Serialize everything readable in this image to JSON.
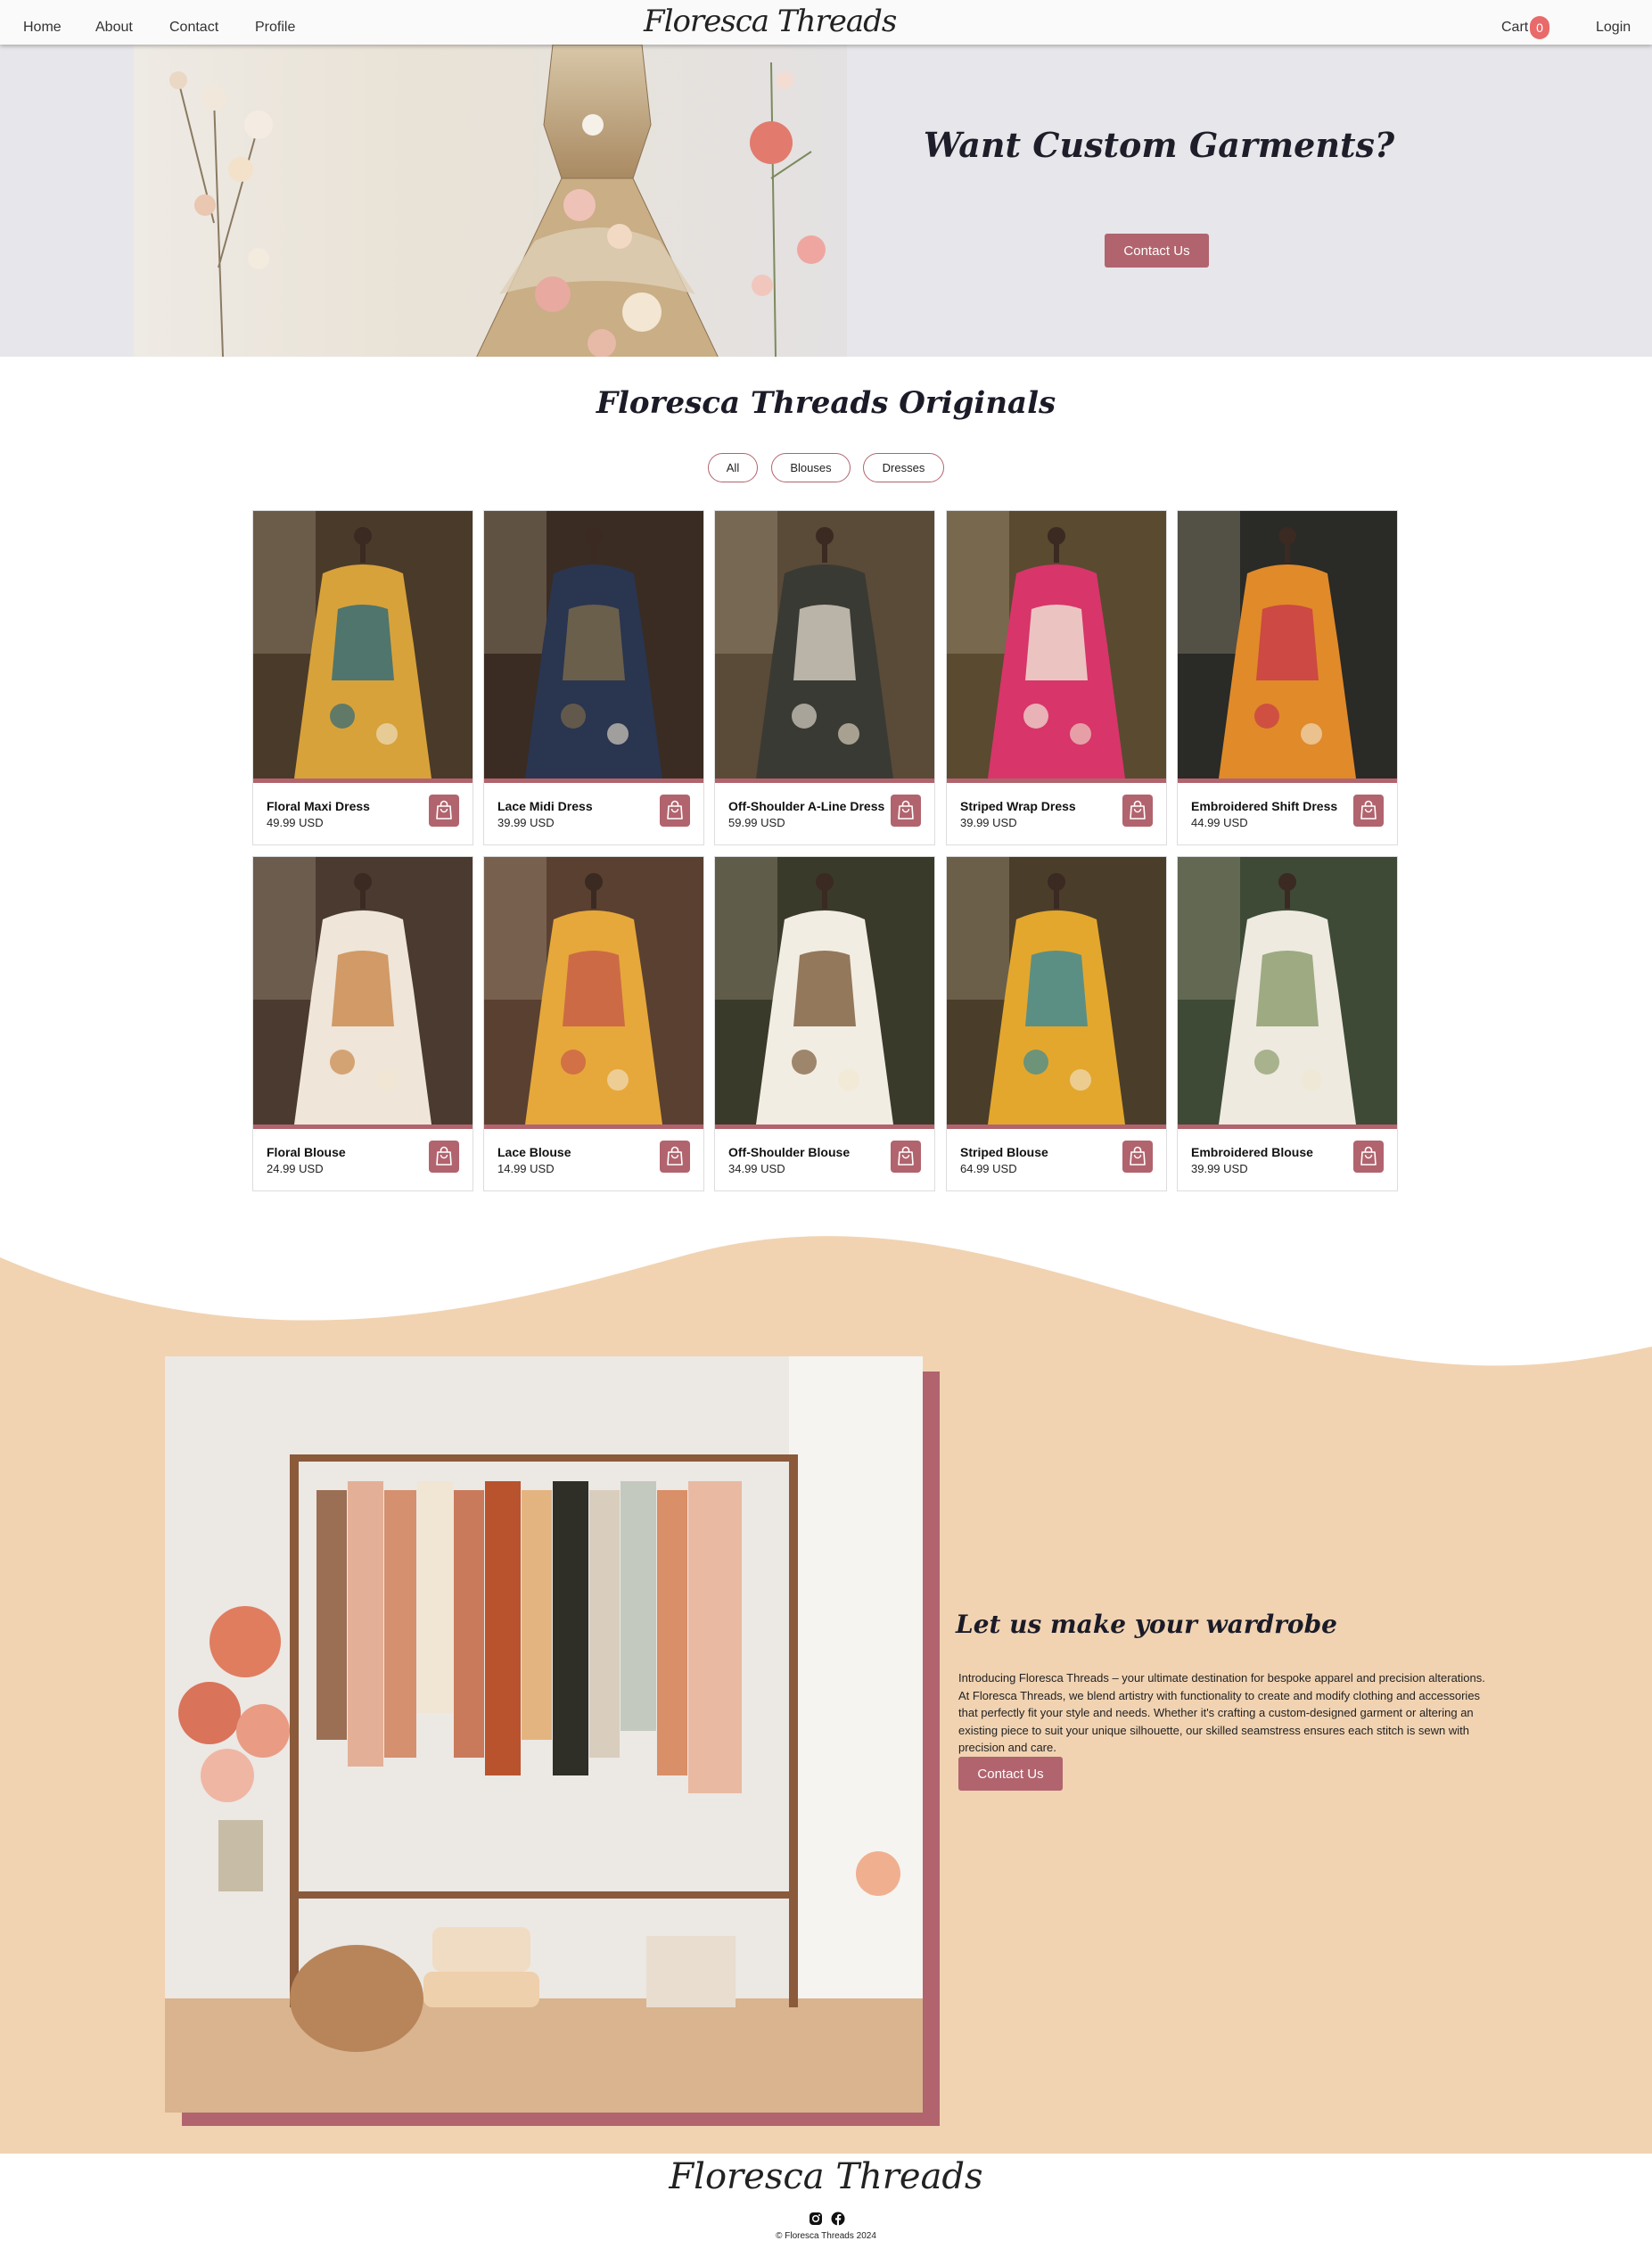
{
  "nav": {
    "links": [
      "Home",
      "About",
      "Contact",
      "Profile"
    ],
    "logo": "Floresca Threads",
    "cart_label": "Cart",
    "cart_count": "0",
    "login": "Login"
  },
  "hero": {
    "title": "Want Custom Garments?",
    "button": "Contact Us"
  },
  "products": {
    "title": "Floresca Threads Originals",
    "filters": [
      "All",
      "Blouses",
      "Dresses"
    ],
    "items": [
      {
        "name": "Floral Maxi Dress",
        "price": "49.99 USD"
      },
      {
        "name": "Lace Midi Dress",
        "price": "39.99 USD"
      },
      {
        "name": "Off-Shoulder A-Line Dress",
        "price": "59.99 USD"
      },
      {
        "name": "Striped Wrap Dress",
        "price": "39.99 USD"
      },
      {
        "name": "Embroidered Shift Dress",
        "price": "44.99 USD"
      },
      {
        "name": "Floral Blouse",
        "price": "24.99 USD"
      },
      {
        "name": "Lace Blouse",
        "price": "14.99 USD"
      },
      {
        "name": "Off-Shoulder Blouse",
        "price": "34.99 USD"
      },
      {
        "name": "Striped Blouse",
        "price": "64.99 USD"
      },
      {
        "name": "Embroidered Blouse",
        "price": "39.99 USD"
      }
    ]
  },
  "about": {
    "title": "Let us make your wardrobe",
    "text": "Introducing Floresca Threads – your ultimate destination for bespoke apparel and precision alterations. At Floresca Threads, we blend artistry with functionality to create and modify clothing and accessories that perfectly fit your style and needs. Whether it's crafting a custom-designed garment or altering an existing piece to suit your unique silhouette, our skilled seamstress ensures each stitch is sewn with precision and care.",
    "button": "Contact Us"
  },
  "footer": {
    "logo": "Floresca Threads",
    "copyright": "© Floresca Threads 2024"
  },
  "colors": {
    "accent": "#b1646e",
    "peach": "#f1d3b2",
    "badge": "#e86a6a"
  },
  "icons": [
    "shopping-bag-icon",
    "instagram-icon",
    "facebook-icon"
  ]
}
